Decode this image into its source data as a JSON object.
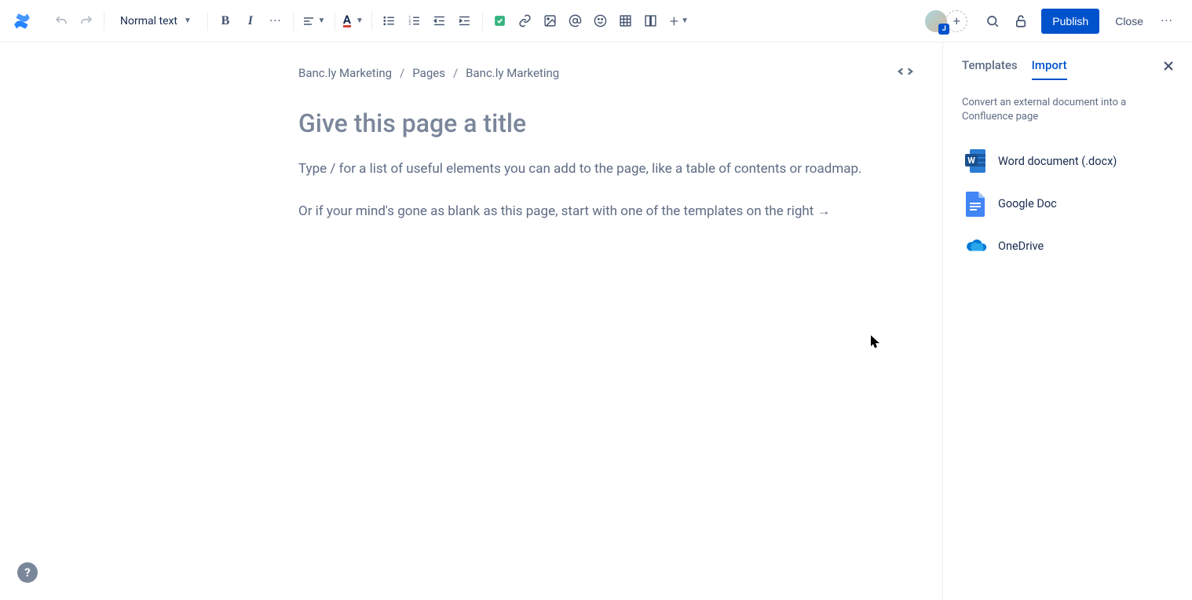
{
  "toolbar": {
    "text_style": "Normal text",
    "publish_label": "Publish",
    "close_label": "Close",
    "avatar_badge": "J"
  },
  "breadcrumb": {
    "items": [
      "Banc.ly Marketing",
      "Pages",
      "Banc.ly Marketing"
    ]
  },
  "editor": {
    "title_placeholder": "Give this page a title",
    "body_line1": "Type / for a list of useful elements you can add to the page, like a table of contents or roadmap.",
    "body_line2": "Or if your mind's gone as blank as this page, start with one of the templates on the right →"
  },
  "panel": {
    "tabs": {
      "templates": "Templates",
      "import": "Import"
    },
    "active_tab": "import",
    "description": "Convert an external document into a Confluence page",
    "import_options": [
      {
        "id": "word",
        "label": "Word document (.docx)"
      },
      {
        "id": "gdoc",
        "label": "Google Doc"
      },
      {
        "id": "onedrive",
        "label": "OneDrive"
      }
    ]
  },
  "help": "?"
}
